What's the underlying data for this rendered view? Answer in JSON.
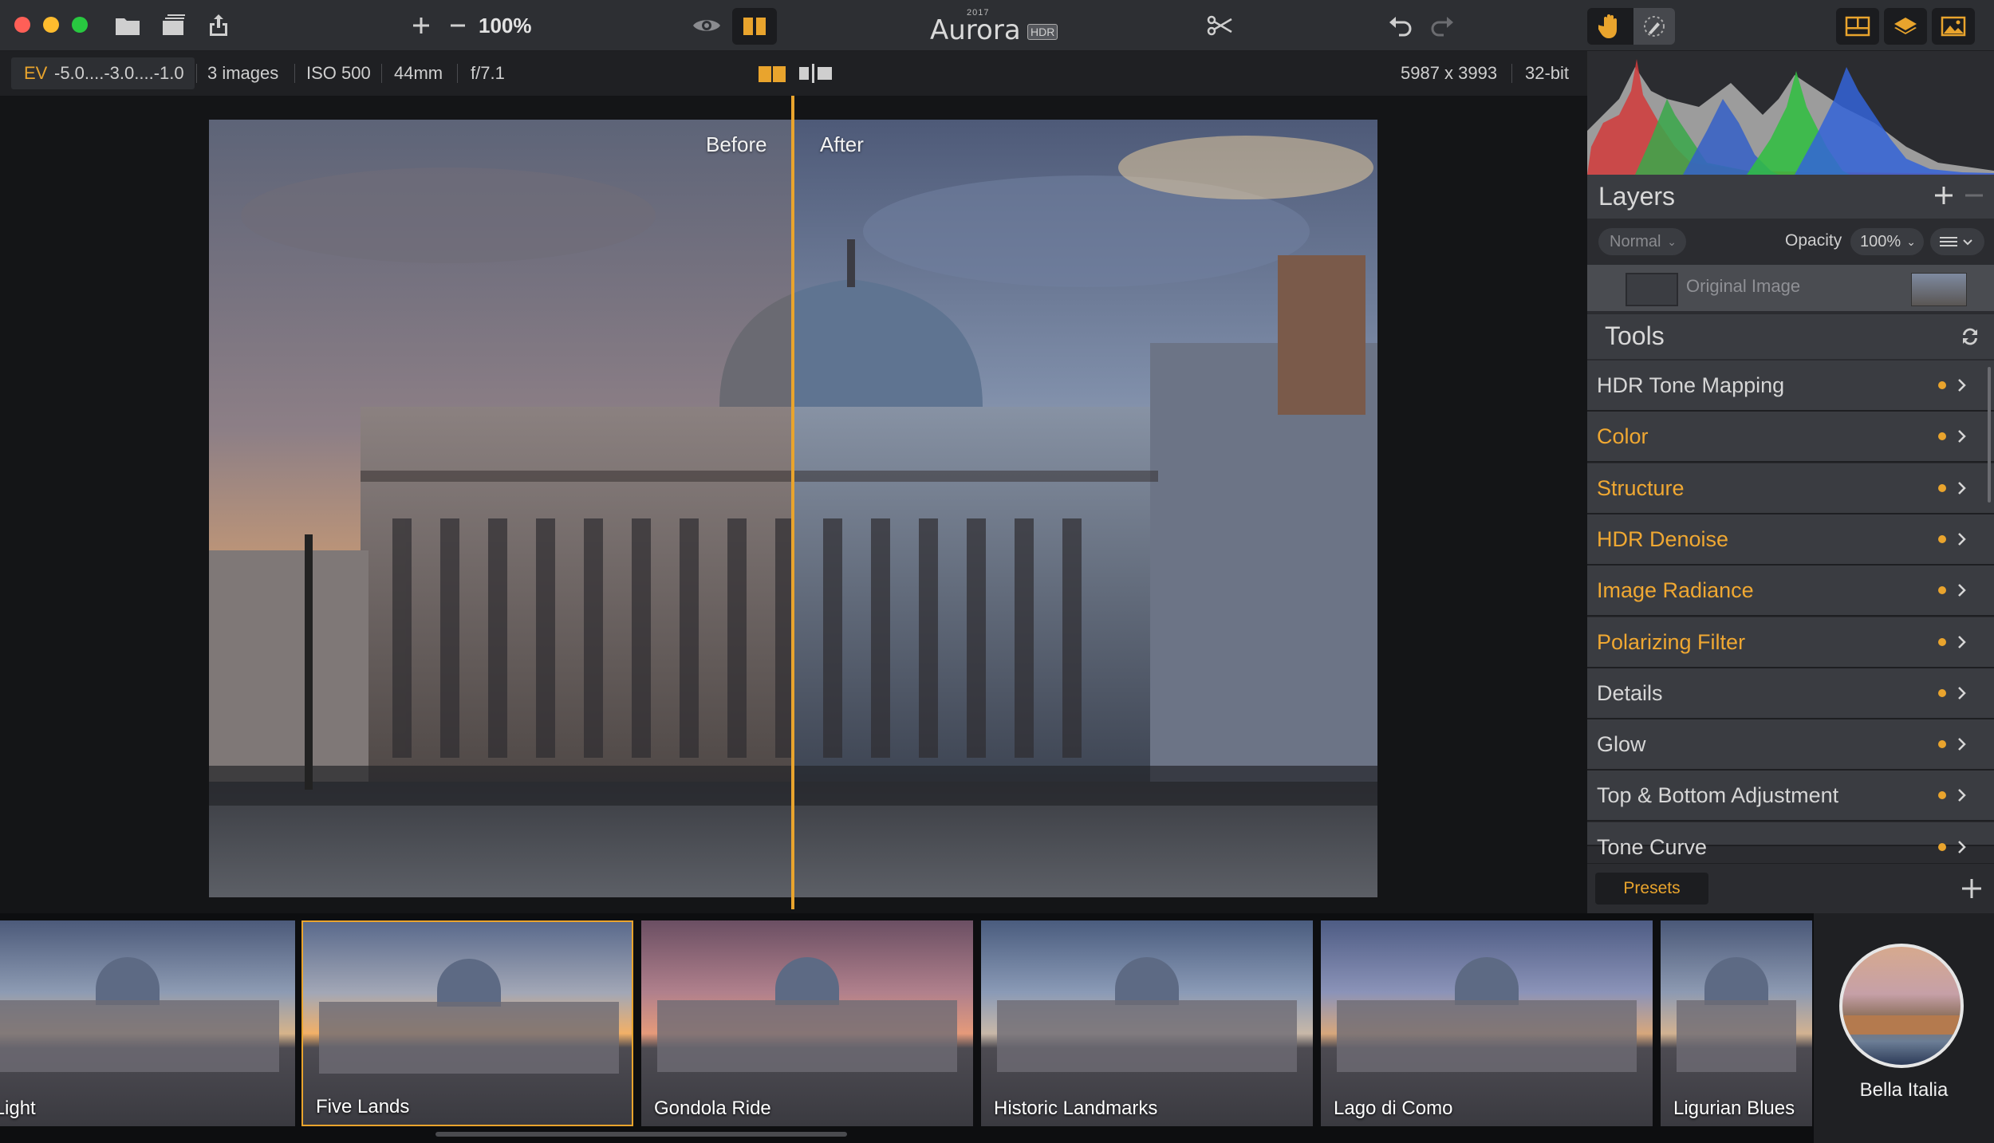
{
  "toolbar": {
    "zoom": "100%",
    "app_name": "Aurora",
    "app_year": "2017",
    "app_badge": "HDR"
  },
  "infobar": {
    "ev_label": "EV",
    "ev_value": "-5.0....-3.0....-1.0",
    "images": "3 images",
    "iso": "ISO 500",
    "focal": "44mm",
    "aperture": "f/7.1",
    "dimensions": "5987 x 3993",
    "bitdepth": "32-bit"
  },
  "canvas": {
    "before_label": "Before",
    "after_label": "After"
  },
  "layers": {
    "title": "Layers",
    "blend_mode": "Normal",
    "opacity_label": "Opacity",
    "opacity_value": "100%",
    "layer_name": "Original Image"
  },
  "tools": {
    "title": "Tools",
    "items": [
      {
        "label": "HDR Tone Mapping",
        "active": false
      },
      {
        "label": "Color",
        "active": true
      },
      {
        "label": "Structure",
        "active": true
      },
      {
        "label": "HDR Denoise",
        "active": true
      },
      {
        "label": "Image Radiance",
        "active": true
      },
      {
        "label": "Polarizing Filter",
        "active": true
      },
      {
        "label": "Details",
        "active": false
      },
      {
        "label": "Glow",
        "active": false
      },
      {
        "label": "Top & Bottom Adjustment",
        "active": false
      },
      {
        "label": "Tone Curve",
        "active": false
      }
    ]
  },
  "presets": {
    "button_label": "Presets",
    "thumbnails": [
      {
        "label": "rk Light"
      },
      {
        "label": "Five Lands"
      },
      {
        "label": "Gondola Ride"
      },
      {
        "label": "Historic Landmarks"
      },
      {
        "label": "Lago di Como"
      },
      {
        "label": "Ligurian Blues"
      }
    ],
    "category": "Bella Italia"
  },
  "colors": {
    "accent": "#e9a42d",
    "toolbar_bg": "#2d2f33",
    "panel_bg": "#2b2c30",
    "row_bg": "#3a3c41",
    "active_text": "#f0a832",
    "inactive_text": "#d6d6d6"
  }
}
